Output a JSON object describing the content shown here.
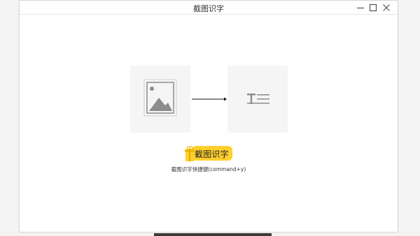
{
  "window": {
    "title": "截图识字"
  },
  "controls": {
    "minimize_icon": "minimize-icon",
    "maximize_icon": "maximize-icon",
    "close_icon": "close-icon"
  },
  "illustration": {
    "source_icon": "image-icon",
    "arrow_icon": "arrow-right-icon",
    "result_icon": "text-icon"
  },
  "main": {
    "capture_button_label": "截图识字",
    "shortcut_hint": "截图识字快捷键(command+y)"
  },
  "colors": {
    "accent": "#ffcf2e",
    "card_bg": "#f5f5f5",
    "icon_gray": "#8c8c8c"
  }
}
